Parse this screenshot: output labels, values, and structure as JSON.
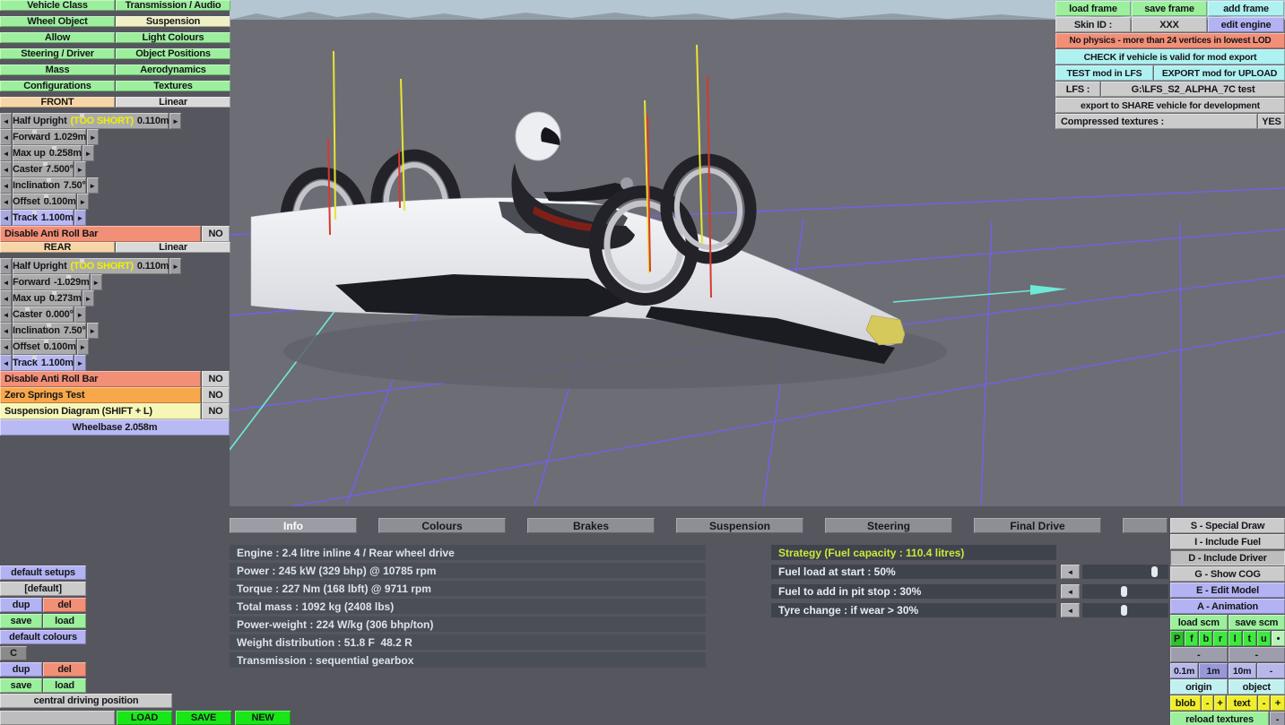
{
  "icons": {
    "left_arrow": "◄",
    "right_arrow": "►"
  },
  "colors": {
    "menu_green": "#9cef9c",
    "selected_pale_yellow": "#f0f0c6",
    "front_orange": "#f6d6a6",
    "linear_grey": "#d9d9d9",
    "slider_grey": "#ababab",
    "track_purple": "#b9b9f4",
    "salmon": "#f28f77",
    "orange": "#f8a84a",
    "pale_yellow": "#f6f6b6",
    "cyan_button": "#aff0f0",
    "purple_button": "#b3b3f3",
    "grey_button": "#cbcbcb",
    "info_row_bg": "#4a4e57",
    "strategy_header_yellow": "#c9e83c",
    "bright_green": "#17e617",
    "tool_yellow": "#f0ee2c",
    "viewport_grey": "#6d6d76",
    "sky_blue": "#b4c6d2",
    "grid_blue": "#6f62e8",
    "axis_cyan": "#6fe9d7",
    "warning_yellow": "#f0f000",
    "suspension_line_yellow": "#e8e432",
    "suspension_line_red": "#d8392e"
  },
  "top_left_menu": {
    "rows": [
      {
        "left": "Vehicle Class",
        "right": "Transmission / Audio"
      },
      {
        "left": "Wheel Object",
        "right": "Suspension"
      },
      {
        "left": "Allow",
        "right": "Light Colours"
      },
      {
        "left": "Steering / Driver",
        "right": "Object Positions"
      },
      {
        "left": "Mass",
        "right": "Aerodynamics"
      },
      {
        "left": "Configurations",
        "right": "Textures"
      }
    ]
  },
  "front_section": {
    "header": "FRONT",
    "mode": "Linear",
    "rows": [
      {
        "label": "Half Upright",
        "warn": "(TOO SHORT)",
        "value": "0.110m"
      },
      {
        "label": "Forward",
        "value": "1.029m"
      },
      {
        "label": "Max up",
        "value": "0.258m"
      },
      {
        "label": "Caster",
        "value": "7.500°"
      },
      {
        "label": "Inclination",
        "value": "7.50°"
      },
      {
        "label": "Offset",
        "value": "0.100m"
      },
      {
        "label": "Track",
        "value": "1.100m"
      }
    ],
    "toggles": [
      {
        "label": "Disable Anti Roll Bar",
        "value": "NO"
      }
    ]
  },
  "rear_section": {
    "header": "REAR",
    "mode": "Linear",
    "rows": [
      {
        "label": "Half Upright",
        "warn": "(TOO SHORT)",
        "value": "0.110m"
      },
      {
        "label": "Forward",
        "value": "-1.029m"
      },
      {
        "label": "Max up",
        "value": "0.273m"
      },
      {
        "label": "Caster",
        "value": "0.000°"
      },
      {
        "label": "Inclination",
        "value": "7.50°"
      },
      {
        "label": "Offset",
        "value": "0.100m"
      },
      {
        "label": "Track",
        "value": "1.100m"
      }
    ],
    "toggles": [
      {
        "label": "Disable Anti Roll Bar",
        "value": "NO"
      },
      {
        "label": "Zero Springs Test",
        "value": "NO"
      },
      {
        "label": "Suspension Diagram (SHIFT + L)",
        "value": "NO"
      }
    ]
  },
  "wheelbase": "Wheelbase 2.058m",
  "top_right_panel": {
    "load_frame": "load frame",
    "save_frame": "save frame",
    "add_frame": "add frame",
    "skin_id_label": "Skin ID :",
    "skin_id_value": "XXX",
    "edit_engine": "edit engine",
    "warning": "No physics - more than 24 vertices in lowest LOD",
    "check": "CHECK if vehicle is valid for mod export",
    "test": "TEST mod in LFS",
    "export": "EXPORT mod for UPLOAD",
    "lfs_label": "LFS :",
    "lfs_path": "G:\\LFS_S2_ALPHA_7C test",
    "share": "export to SHARE vehicle for development",
    "compressed_label": "Compressed textures :",
    "compressed_value": "YES"
  },
  "tabs": {
    "items": [
      {
        "label": "Info"
      },
      {
        "label": "Colours"
      },
      {
        "label": "Brakes"
      },
      {
        "label": "Suspension"
      },
      {
        "label": "Steering"
      },
      {
        "label": "Final Drive"
      }
    ]
  },
  "info_panel": {
    "rows": [
      "Engine : 2.4 litre inline 4 / Rear wheel drive",
      "Power : 245 kW (329 bhp) @ 10785 rpm",
      "Torque : 227 Nm (168 lbft) @ 9711 rpm",
      "Total mass : 1092 kg (2408 lbs)",
      "Power-weight : 224 W/kg (306 bhp/ton)",
      "Weight distribution : 51.8 F  48.2 R",
      "Transmission : sequential gearbox"
    ]
  },
  "strategy_panel": {
    "header": "Strategy (Fuel capacity : 110.4 litres)",
    "rows": [
      {
        "label": "Fuel load at start : 50%",
        "slider_percent": 80
      },
      {
        "label": "Fuel to add in pit stop : 30%",
        "slider_percent": 45
      },
      {
        "label": "Tyre change : if wear > 30%",
        "slider_percent": 45
      }
    ]
  },
  "setups_panel": {
    "title": "default setups",
    "current": "[default]",
    "dup": "dup",
    "del": "del",
    "save": "save",
    "load": "load"
  },
  "colours_panel": {
    "title": "default colours",
    "current": "C",
    "dup": "dup",
    "del": "del",
    "save": "save",
    "load": "load"
  },
  "driving_position": "central driving position",
  "file_bar": {
    "load": "LOAD",
    "save": "SAVE",
    "new": "NEW"
  },
  "right_tools": {
    "special_draw": "S - Special Draw",
    "include_fuel": "I - Include Fuel",
    "include_driver": "D - Include Driver",
    "show_cog": "G - Show COG",
    "edit_model": "E - Edit Model",
    "animation": "A - Animation",
    "load_scm": "load scm",
    "save_scm": "save scm",
    "view_letters": [
      "P",
      "f",
      "b",
      "r",
      "l",
      "t",
      "u",
      "•"
    ],
    "minus_a": "-",
    "minus_b": "-",
    "grid_sizes": [
      "0.1m",
      "1m",
      "10m",
      "-"
    ],
    "origin": "origin",
    "object": "object",
    "blob": "blob",
    "blob_minus": "-",
    "blob_plus": "+",
    "text": "text",
    "text_minus": "-",
    "text_plus": "+",
    "reload_textures": "reload textures",
    "reload_minus": "-"
  }
}
